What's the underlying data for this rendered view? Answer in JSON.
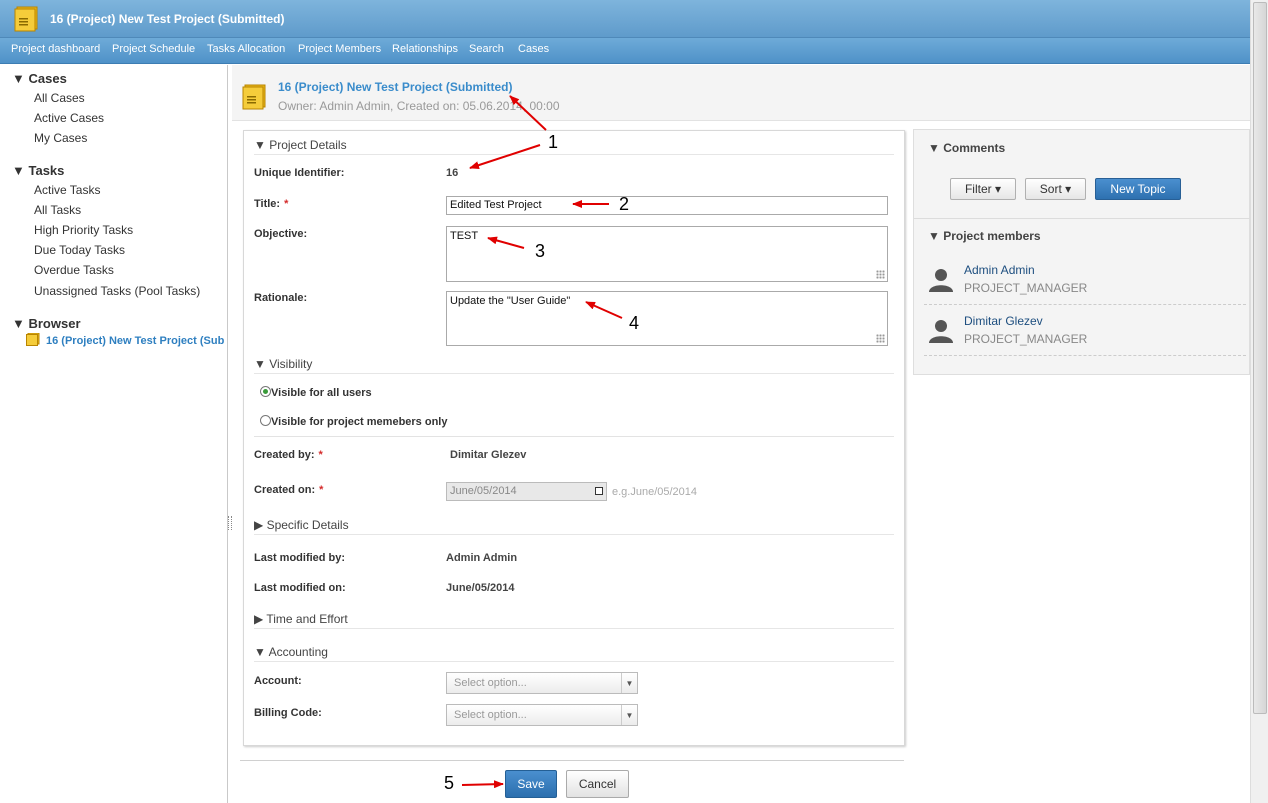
{
  "header": {
    "title": "16 (Project) New Test Project (Submitted)"
  },
  "nav": [
    "Project dashboard",
    "Project Schedule",
    "Tasks Allocation",
    "Project Members",
    "Relationships",
    "Search",
    "Cases"
  ],
  "sidebar": {
    "cases_header": "Cases",
    "cases_items": [
      "All Cases",
      "Active Cases",
      "My Cases"
    ],
    "tasks_header": "Tasks",
    "tasks_items": [
      "Active Tasks",
      "All Tasks",
      "High Priority Tasks",
      "Due Today Tasks",
      "Overdue Tasks",
      "Unassigned Tasks (Pool Tasks)"
    ],
    "browser_header": "Browser",
    "browser_item": "16 (Project) New Test Project (Sub"
  },
  "page_head": {
    "title": "16 (Project) New Test Project (Submitted)",
    "subtitle": "Owner: Admin Admin, Created on: 05.06.2014, 00:00"
  },
  "form": {
    "project_details_header": "Project Details",
    "unique_id_label": "Unique Identifier:",
    "unique_id_value": "16",
    "title_label": "Title:",
    "title_value": "Edited Test Project",
    "objective_label": "Objective:",
    "objective_value": "TEST",
    "rationale_label": "Rationale:",
    "rationale_value": "Update the \"User Guide\"",
    "visibility_header": "Visibility",
    "visibility_all": "Visible for all users",
    "visibility_members": "Visible for project memebers only",
    "created_by_label": "Created by:",
    "created_by_value": "Dimitar Glezev",
    "created_on_label": "Created on:",
    "created_on_value": "June/05/2014",
    "created_on_hint": "e.g.June/05/2014",
    "specific_details_header": "Specific Details",
    "last_modified_by_label": "Last modified by:",
    "last_modified_by_value": "Admin Admin",
    "last_modified_on_label": "Last modified on:",
    "last_modified_on_value": "June/05/2014",
    "time_effort_header": "Time and Effort",
    "accounting_header": "Accounting",
    "account_label": "Account:",
    "account_placeholder": "Select option...",
    "billing_label": "Billing Code:",
    "billing_placeholder": "Select option...",
    "save_label": "Save",
    "cancel_label": "Cancel"
  },
  "right_panel": {
    "comments_header": "Comments",
    "filter_label": "Filter",
    "sort_label": "Sort",
    "new_topic_label": "New Topic",
    "members_header": "Project members",
    "members": [
      {
        "name": "Admin Admin",
        "role": "PROJECT_MANAGER"
      },
      {
        "name": "Dimitar Glezev",
        "role": "PROJECT_MANAGER"
      }
    ]
  },
  "annotations": [
    "1",
    "2",
    "3",
    "4",
    "5"
  ],
  "colors": {
    "header": "#6aa6d4",
    "link": "#3a8ccb",
    "primary_button": "#2f72b1",
    "annotation": "#e00000"
  }
}
